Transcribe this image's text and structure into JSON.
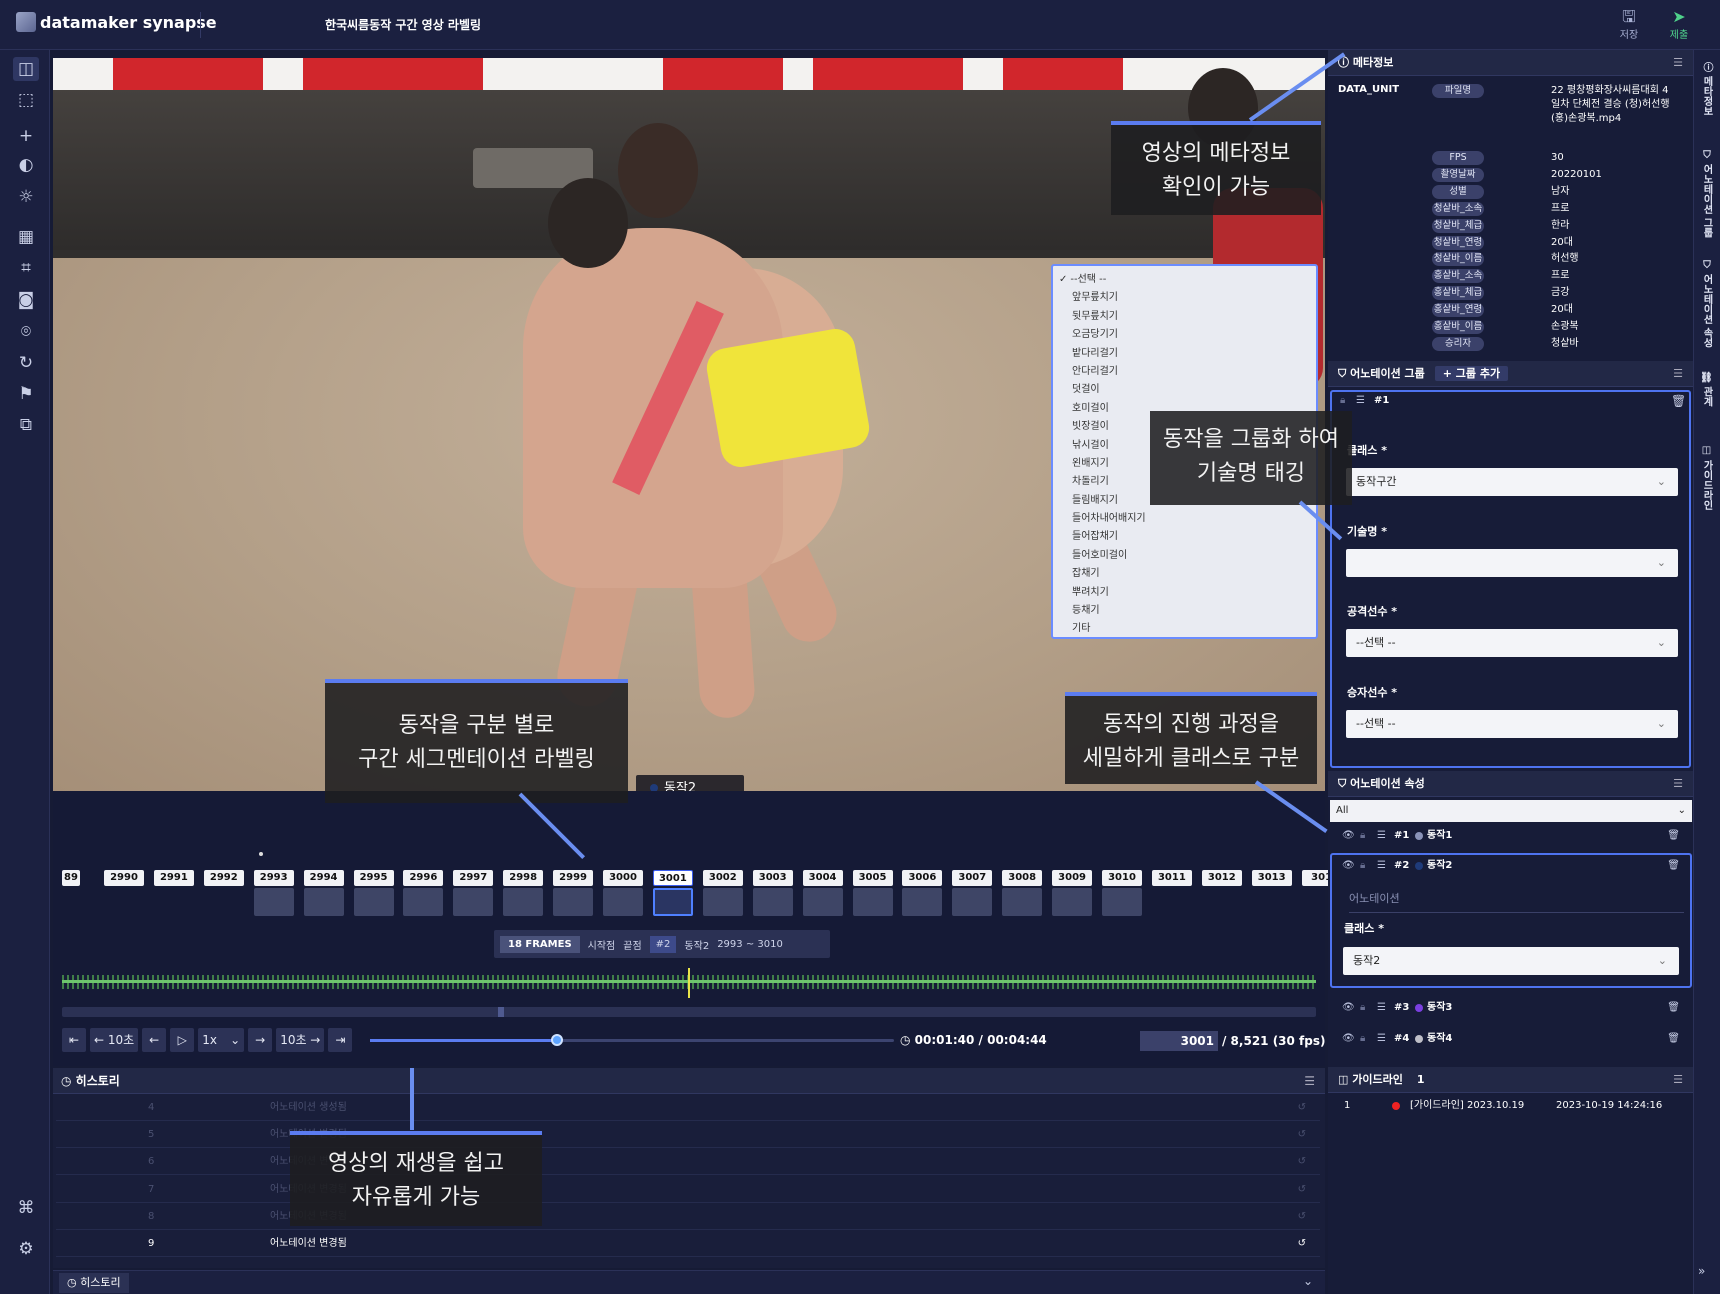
{
  "app": {
    "brand": "datamaker synapse",
    "project_title": "한국씨름동작 구간 영상 라벨링"
  },
  "toolbar": {
    "save_label": "저장",
    "submit_label": "제출"
  },
  "video": {
    "label_tag": "동작2",
    "dropdown_options": [
      "--선택 --",
      "앞무릎치기",
      "뒷무릎치기",
      "오금당기기",
      "밭다리걸기",
      "안다리걸기",
      "덧걸이",
      "호미걸이",
      "빗장걸이",
      "낚시걸이",
      "왼배지기",
      "차돌리기",
      "들림배지기",
      "들어차내어배지기",
      "들어잡채기",
      "들어호미걸이",
      "잡채기",
      "뿌려치기",
      "등채기",
      "기타"
    ],
    "callouts": {
      "meta": [
        "영상의 메타정보",
        "확인이 가능"
      ],
      "group": [
        "동작을 그룹화 하여",
        "기술명 태깅"
      ],
      "segment": [
        "동작을 구분 별로",
        "구간 세그멘테이션 라벨링"
      ],
      "class": [
        "동작의 진행 과정을",
        "세밀하게 클래스로 구분"
      ],
      "play": [
        "영상의 재생을 쉽고",
        "자유롭게 가능"
      ]
    }
  },
  "timeline": {
    "frames": [
      "89",
      "2990",
      "2991",
      "2992",
      "2993",
      "2994",
      "2995",
      "2996",
      "2997",
      "2998",
      "2999",
      "3000",
      "3001",
      "3002",
      "3003",
      "3004",
      "3005",
      "3006",
      "3007",
      "3008",
      "3009",
      "3010",
      "3011",
      "3012",
      "3013",
      "301"
    ],
    "current_frame_label": "3001",
    "segment": {
      "frames": "18 FRAMES",
      "start": "시작점",
      "end": "끝점",
      "id": "#2",
      "name": "동작2",
      "range": "2993 ~ 3010"
    },
    "controls": {
      "first": "⇤",
      "back10": "← 10초",
      "prev": "←",
      "play": "▷",
      "speed": "1x",
      "next": "→",
      "fwd10": "10초 →",
      "last": "⇥"
    },
    "time": "00:01:40 / 00:04:44",
    "frame_current": "3001",
    "frame_total": "/ 8,521 (30 fps)",
    "playback_progress": 0.352
  },
  "history": {
    "title": "히스토리",
    "rows": [
      {
        "n": "4",
        "text": "어노테이션 생성됨"
      },
      {
        "n": "5",
        "text": "어노테이션 변경됨"
      },
      {
        "n": "6",
        "text": "어노테이션 변경됨"
      },
      {
        "n": "7",
        "text": "어노테이션 변경됨"
      },
      {
        "n": "8",
        "text": "어노테이션 변경됨"
      },
      {
        "n": "9",
        "text": "어노테이션 변경됨"
      }
    ],
    "bottom_tab": "히스토리"
  },
  "meta": {
    "title": "메타정보",
    "unit": "DATA_UNIT",
    "file_key": "파일명",
    "file_value": "22 평창평화장사씨름대회 4일차 단체전 결승 (청)허선행(홍)손광복.mp4",
    "rows": [
      {
        "k": "FPS",
        "v": "30"
      },
      {
        "k": "촬영날짜",
        "v": "20220101"
      },
      {
        "k": "성별",
        "v": "남자"
      },
      {
        "k": "청샅바_소속",
        "v": "프로"
      },
      {
        "k": "청샅바_체급",
        "v": "한라"
      },
      {
        "k": "청샅바_연령",
        "v": "20대"
      },
      {
        "k": "청샅바_이름",
        "v": "허선행"
      },
      {
        "k": "홍샅바_소속",
        "v": "프로"
      },
      {
        "k": "홍샅바_체급",
        "v": "금강"
      },
      {
        "k": "홍샅바_연령",
        "v": "20대"
      },
      {
        "k": "홍샅바_이름",
        "v": "손광복"
      },
      {
        "k": "승리자",
        "v": "청샅바"
      }
    ]
  },
  "group": {
    "title": "어노테이션 그룹",
    "add_label": "+ 그룹 추가",
    "id": "#1",
    "class_label": "클래스 *",
    "class_value": "동작구간",
    "skill_label": "기술명 *",
    "skill_value": "",
    "attacker_label": "공격선수 *",
    "attacker_value": "--선택 --",
    "winner_label": "승자선수 *",
    "winner_value": "--선택 --"
  },
  "attrs": {
    "title": "어노테이션 속성",
    "filter": "All",
    "items": [
      {
        "id": "#1",
        "name": "동작1",
        "color": "#8a93b8"
      },
      {
        "id": "#2",
        "name": "동작2",
        "color": "#1f3b7a"
      },
      {
        "id": "#3",
        "name": "동작3",
        "color": "#7b3fe0"
      },
      {
        "id": "#4",
        "name": "동작4",
        "color": "#bfbfc8"
      }
    ],
    "sub_label": "어노테이션",
    "class_label": "클래스 *",
    "class_value": "동작2"
  },
  "guide": {
    "title": "가이드라인",
    "count": "1",
    "row": {
      "n": "1",
      "name": "[가이드라인] 2023.10.19",
      "date": "2023-10-19 14:24:16"
    }
  },
  "side_tabs": [
    "메타정보",
    "어노테이션 그룹",
    "어노테이션 속성",
    "관계",
    "가이드라인"
  ]
}
